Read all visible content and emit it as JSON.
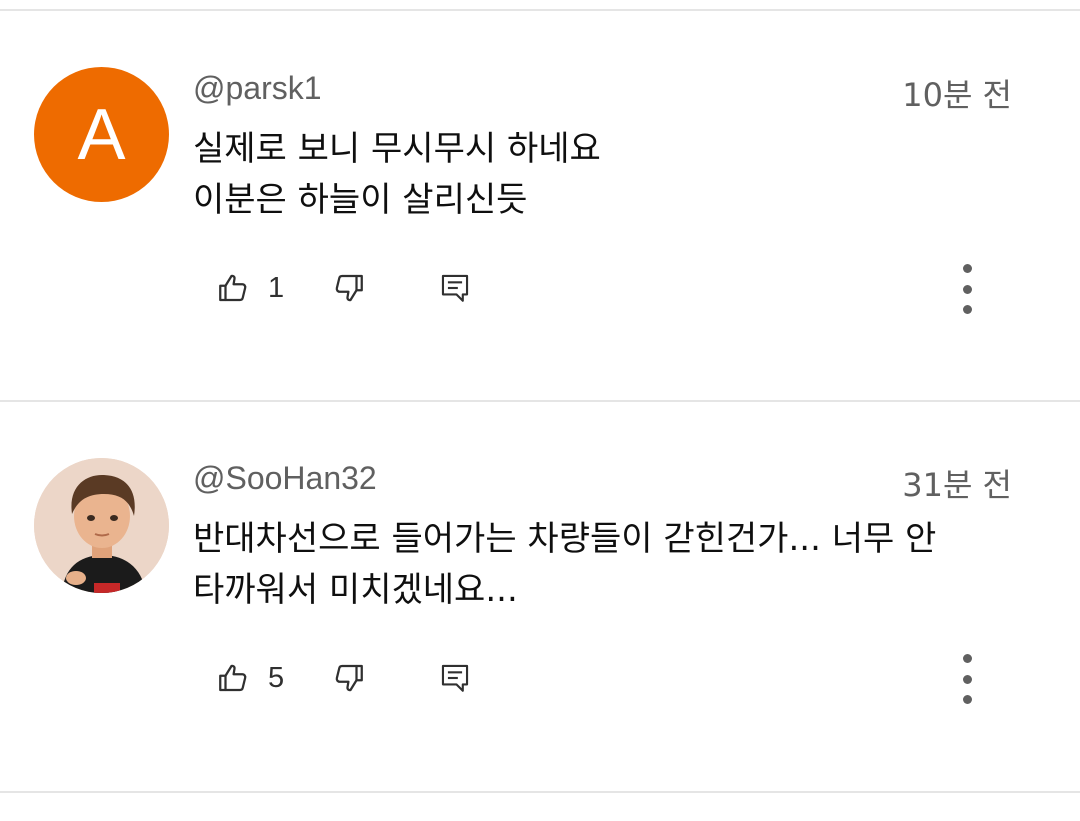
{
  "comments": [
    {
      "author": "@parsk1",
      "time": "10분 전",
      "lines": [
        "실제로 보니 무시무시 하네요",
        "이분은 하늘이 살리신듯"
      ],
      "likes": "1",
      "avatar_letter": "A",
      "avatar_color": "#ee6b00"
    },
    {
      "author": "@SooHan32",
      "time": "31분 전",
      "lines": [
        "반대차선으로 들어가는 차량들이 갇힌건가... 너무 안",
        "타까워서 미치겠네요..."
      ],
      "likes": "5",
      "avatar_color": "#ecd6c8"
    }
  ],
  "icons": {
    "like": "thumb-up-icon",
    "dislike": "thumb-down-icon",
    "reply": "reply-icon",
    "more": "more-vertical-icon"
  }
}
